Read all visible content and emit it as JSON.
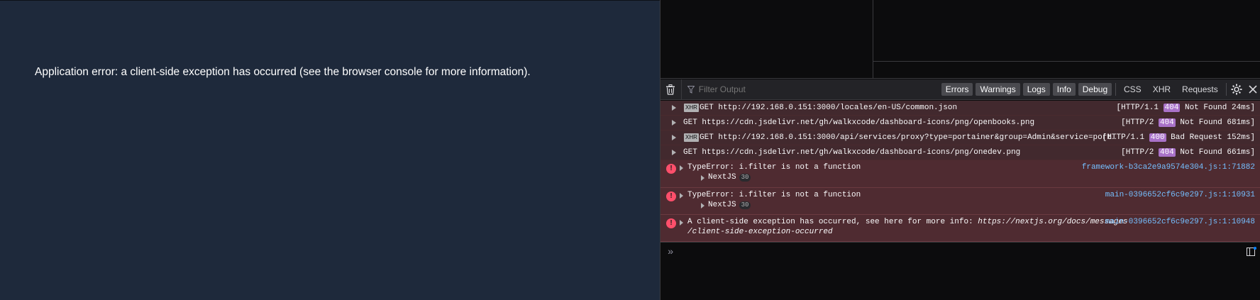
{
  "app": {
    "error_message": "Application error: a client-side exception has occurred (see the browser console for more information)."
  },
  "toolbar": {
    "filter_placeholder": "Filter Output",
    "filters": [
      "Errors",
      "Warnings",
      "Logs",
      "Info",
      "Debug"
    ],
    "extra": [
      "CSS",
      "XHR",
      "Requests"
    ]
  },
  "network_rows": [
    {
      "xhr": "XHR",
      "text": "GET http://192.168.0.151:3000/locales/en-US/common.json",
      "proto": "[HTTP/1.1",
      "code": "404",
      "rest": "Not Found 24ms]"
    },
    {
      "xhr": "",
      "text": "GET https://cdn.jsdelivr.net/gh/walkxcode/dashboard-icons/png/openbooks.png",
      "proto": "[HTTP/2",
      "code": "404",
      "rest": "Not Found 681ms]"
    },
    {
      "xhr": "XHR",
      "text": "GET http://192.168.0.151:3000/api/services/proxy?type=portainer&group=Admin&service=portainer&e…",
      "proto": "[HTTP/1.1",
      "code": "400",
      "rest": "Bad Request 152ms]"
    },
    {
      "xhr": "",
      "text": "GET https://cdn.jsdelivr.net/gh/walkxcode/dashboard-icons/png/onedev.png",
      "proto": "[HTTP/2",
      "code": "404",
      "rest": "Not Found 661ms]"
    }
  ],
  "errors": [
    {
      "message": "TypeError: i.filter is not a function",
      "source": "framework-b3ca2e9a9574e304.js:1:71882",
      "sub_label": "NextJS",
      "sub_count": "30"
    },
    {
      "message": "TypeError: i.filter is not a function",
      "source": "main-0396652cf6c9e297.js:1:10931",
      "sub_label": "NextJS",
      "sub_count": "30"
    },
    {
      "message": "A client-side exception has occurred, see here for more info: ",
      "url": "https://nextjs.org/docs/messages",
      "url2": "/client-side-exception-occurred",
      "source": "main-0396652cf6c9e297.js:1:10948"
    }
  ],
  "console_input": {
    "prompt": "»"
  },
  "colors": {
    "app_bg": "#1e293b",
    "devtools_bg": "#0c0c0d",
    "error_row_bg": "#4f2b31",
    "status_badge": "#a972c9",
    "source_link": "#75bfff",
    "error_icon": "#ff4f6b"
  }
}
